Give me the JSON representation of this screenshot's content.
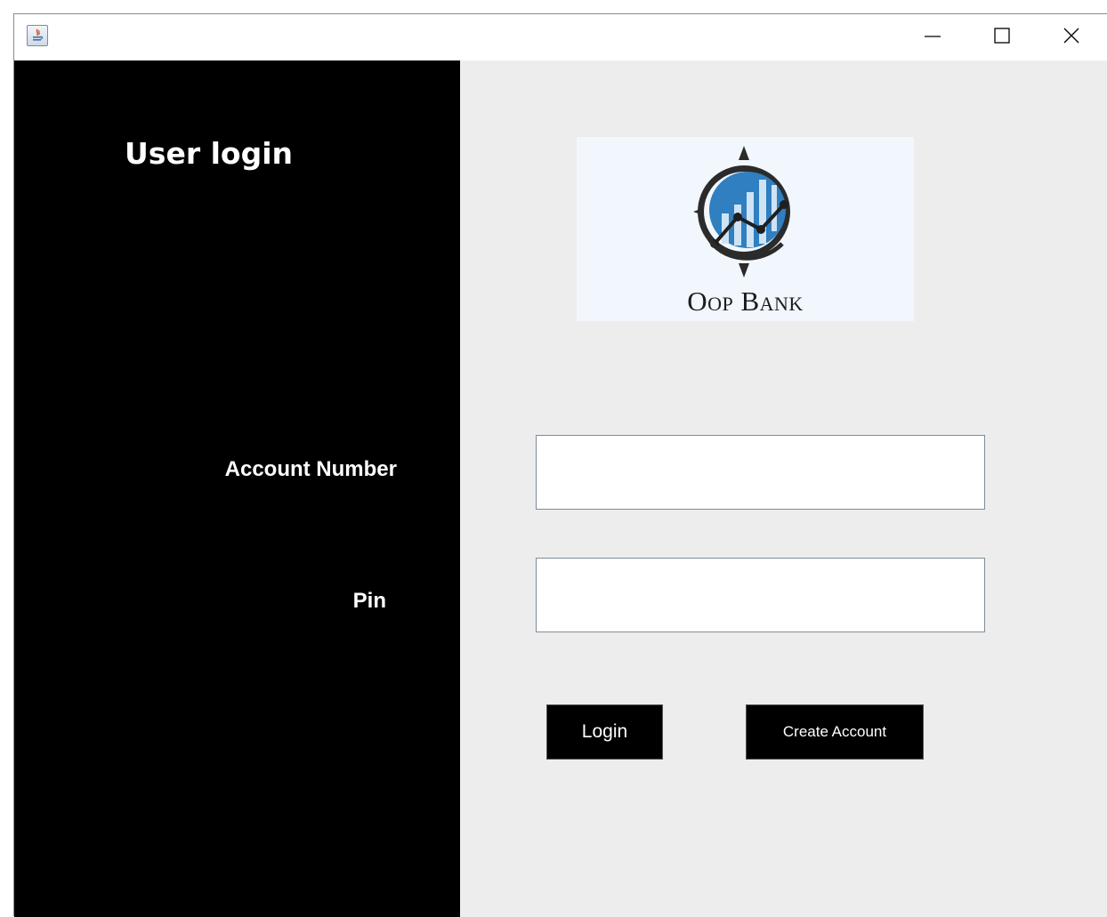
{
  "window": {
    "icon": "java-app-icon",
    "controls": {
      "minimize": "minimize-icon",
      "maximize": "maximize-icon",
      "close": "close-icon"
    }
  },
  "login_panel": {
    "title": "User login",
    "account_number_label": "Account Number",
    "pin_label": "Pin"
  },
  "logo": {
    "text": "Oop Bank",
    "icon": "compass-chart-logo"
  },
  "form": {
    "account_number_value": "",
    "pin_value": "",
    "login_label": "Login",
    "create_account_label": "Create Account"
  },
  "colors": {
    "left_panel": "#000000",
    "right_panel": "#ededed",
    "logo_blue": "#2f7fc1",
    "button_bg": "#000000"
  }
}
